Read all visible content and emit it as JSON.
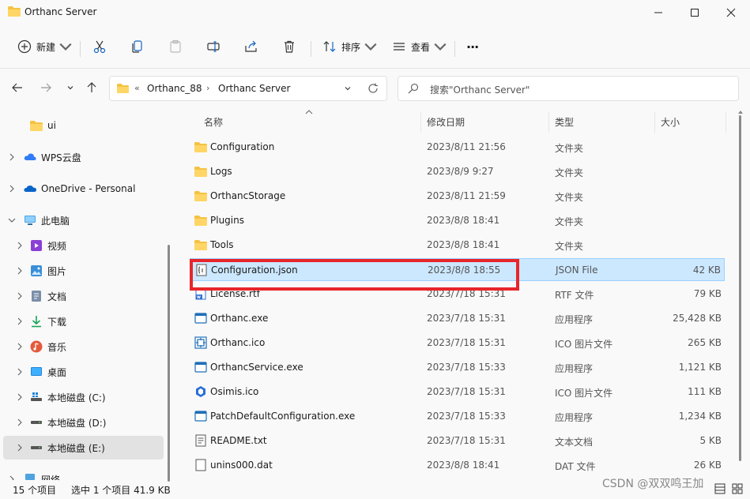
{
  "window": {
    "title": "Orthanc Server",
    "minimize_icon": "minimize-icon",
    "maximize_icon": "maximize-icon",
    "close_icon": "close-icon"
  },
  "toolbar": {
    "new_label": "新建",
    "sort_label": "排序",
    "view_label": "查看",
    "more_label": "···"
  },
  "address": {
    "overflow": "«",
    "segments": [
      "Orthanc_88",
      "Orthanc Server"
    ],
    "separator": "›"
  },
  "search": {
    "placeholder": "搜索\"Orthanc Server\""
  },
  "sidebar": {
    "items": [
      {
        "label": "ui",
        "icon": "folder-icon"
      },
      {
        "label": "WPS云盘",
        "icon": "wps-cloud-icon"
      },
      {
        "label": "OneDrive - Personal",
        "icon": "onedrive-icon"
      },
      {
        "label": "此电脑",
        "icon": "computer-icon"
      },
      {
        "label": "视频",
        "icon": "video-icon"
      },
      {
        "label": "图片",
        "icon": "pictures-icon"
      },
      {
        "label": "文档",
        "icon": "documents-icon"
      },
      {
        "label": "下载",
        "icon": "download-icon"
      },
      {
        "label": "音乐",
        "icon": "music-icon"
      },
      {
        "label": "桌面",
        "icon": "desktop-icon"
      },
      {
        "label": "本地磁盘 (C:)",
        "icon": "drive-icon"
      },
      {
        "label": "本地磁盘 (D:)",
        "icon": "drive-icon"
      },
      {
        "label": "本地磁盘 (E:)",
        "icon": "drive-icon"
      },
      {
        "label": "网络",
        "icon": "network-icon"
      }
    ]
  },
  "columns": {
    "name": "名称",
    "date": "修改日期",
    "type": "类型",
    "size": "大小"
  },
  "files": [
    {
      "name": "Configuration",
      "date": "2023/8/11 21:56",
      "type": "文件夹",
      "size": "",
      "icon": "folder"
    },
    {
      "name": "Logs",
      "date": "2023/8/9 9:27",
      "type": "文件夹",
      "size": "",
      "icon": "folder"
    },
    {
      "name": "OrthancStorage",
      "date": "2023/8/11 21:59",
      "type": "文件夹",
      "size": "",
      "icon": "folder"
    },
    {
      "name": "Plugins",
      "date": "2023/8/8 18:41",
      "type": "文件夹",
      "size": "",
      "icon": "folder"
    },
    {
      "name": "Tools",
      "date": "2023/8/8 18:41",
      "type": "文件夹",
      "size": "",
      "icon": "folder"
    },
    {
      "name": "Configuration.json",
      "date": "2023/8/8 18:55",
      "type": "JSON File",
      "size": "42 KB",
      "icon": "json"
    },
    {
      "name": "License.rtf",
      "date": "2023/7/18 15:31",
      "type": "RTF 文件",
      "size": "79 KB",
      "icon": "rtf"
    },
    {
      "name": "Orthanc.exe",
      "date": "2023/7/18 15:31",
      "type": "应用程序",
      "size": "25,428 KB",
      "icon": "exe"
    },
    {
      "name": "Orthanc.ico",
      "date": "2023/7/18 15:31",
      "type": "ICO 图片文件",
      "size": "265 KB",
      "icon": "ico"
    },
    {
      "name": "OrthancService.exe",
      "date": "2023/7/18 15:33",
      "type": "应用程序",
      "size": "1,121 KB",
      "icon": "exe"
    },
    {
      "name": "Osimis.ico",
      "date": "2023/7/18 15:31",
      "type": "ICO 图片文件",
      "size": "111 KB",
      "icon": "osimis"
    },
    {
      "name": "PatchDefaultConfiguration.exe",
      "date": "2023/7/18 15:33",
      "type": "应用程序",
      "size": "1,234 KB",
      "icon": "exe"
    },
    {
      "name": "README.txt",
      "date": "2023/7/18 15:31",
      "type": "文本文档",
      "size": "5 KB",
      "icon": "txt"
    },
    {
      "name": "unins000.dat",
      "date": "2023/8/8 18:41",
      "type": "DAT 文件",
      "size": "26 KB",
      "icon": "dat"
    }
  ],
  "status": {
    "count": "15 个项目",
    "selected": "选中 1 个项目  41.9 KB"
  },
  "watermark": "CSDN @双双鸣王加",
  "colors": {
    "selection_bg": "#cce8ff",
    "selection_border": "#99d1ff",
    "highlight_box": "#e8252b",
    "folder": "#f5c242"
  }
}
